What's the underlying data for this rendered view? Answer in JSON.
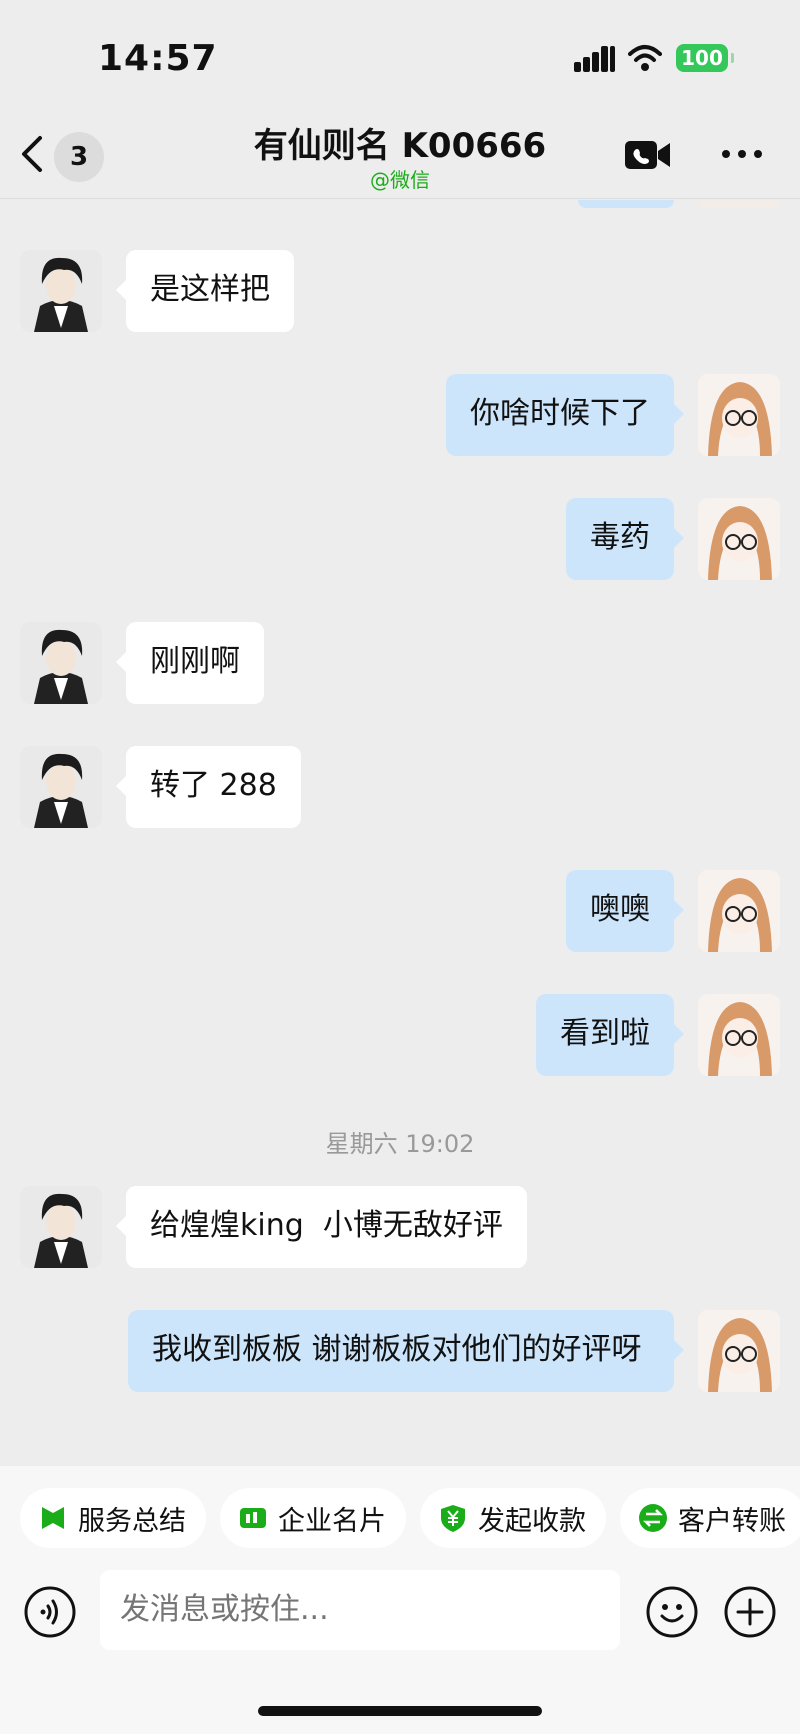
{
  "status_bar": {
    "time": "14:57",
    "battery": "100"
  },
  "header": {
    "back_badge": "3",
    "title": "有仙则名 K00666",
    "subtitle": "@微信"
  },
  "messages": [
    {
      "side": "in",
      "text": "是这样把"
    },
    {
      "side": "out",
      "text": "你啥时候下了"
    },
    {
      "side": "out",
      "text": "毒药"
    },
    {
      "side": "in",
      "text": "刚刚啊"
    },
    {
      "side": "in",
      "text": "转了 288"
    },
    {
      "side": "out",
      "text": "噢噢"
    },
    {
      "side": "out",
      "text": "看到啦"
    },
    {
      "side": "timestamp",
      "text": "星期六 19:02"
    },
    {
      "side": "in",
      "text": "给煌煌king  小博无敌好评"
    },
    {
      "side": "out",
      "text": "我收到板板 谢谢板板对他们的好评呀"
    }
  ],
  "quick_actions": [
    {
      "label": "服务总结",
      "icon": "bookmark-icon"
    },
    {
      "label": "企业名片",
      "icon": "card-icon"
    },
    {
      "label": "发起收款",
      "icon": "yen-shield-icon"
    },
    {
      "label": "客户转账",
      "icon": "transfer-icon"
    }
  ],
  "input": {
    "placeholder": "发消息或按住..."
  },
  "colors": {
    "accent": "#1aad19",
    "outgoing_bubble": "#cde5fb",
    "incoming_bubble": "#ffffff",
    "background": "#ededed"
  }
}
